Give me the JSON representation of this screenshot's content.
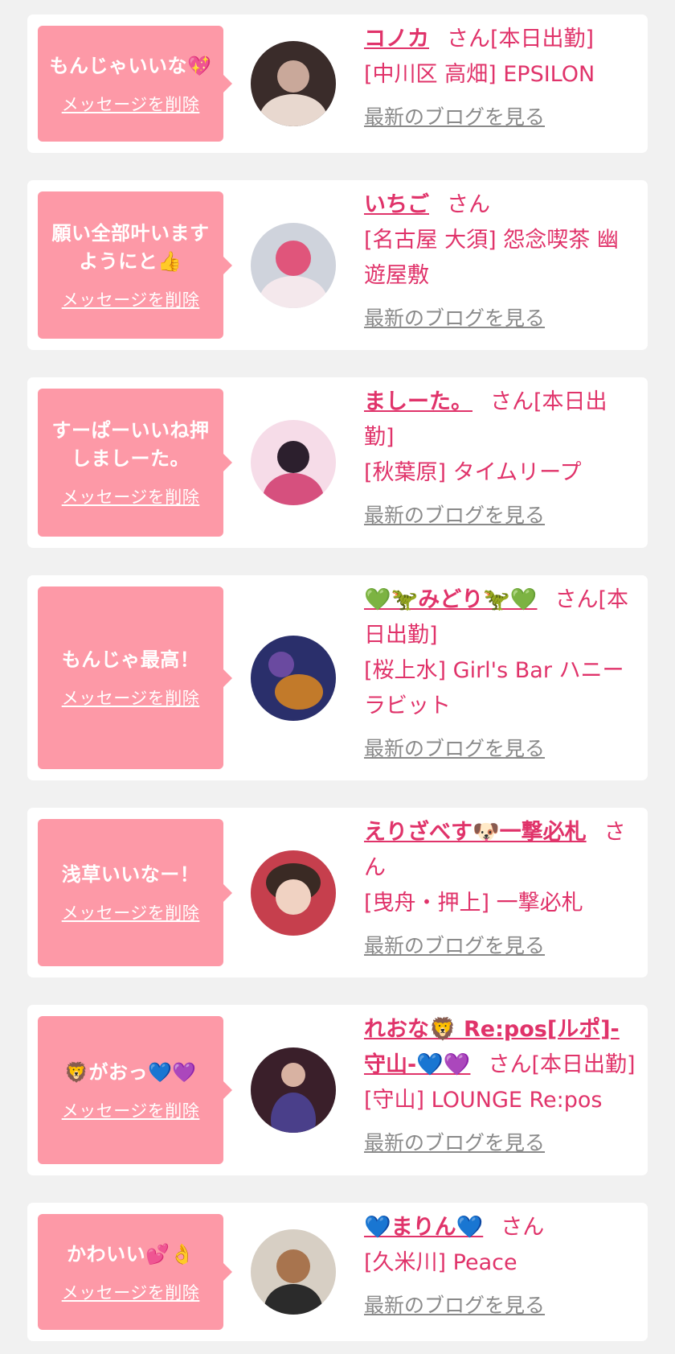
{
  "colors": {
    "page_bg": "#f1f1f1",
    "bubble_bg": "#fd99a7",
    "accent_text": "#e0336a",
    "blog_link": "#8a8a8a"
  },
  "delete_label": "メッセージを削除",
  "blog_label": "最新のブログを見る",
  "cards": [
    {
      "message": "もんじゃいいな💖",
      "name": "コノカ",
      "san": "さん[本日出勤]",
      "shop": "[中川区 高畑] EPSILON",
      "avatar_colors": [
        "#3a2c2a",
        "#e8d8cf",
        "#c9a89a"
      ]
    },
    {
      "message": "願い全部叶いますようにと👍",
      "name": "いちご",
      "san": "さん",
      "shop": "[名古屋 大須] 怨念喫茶 幽遊屋敷",
      "avatar_colors": [
        "#cfd3dc",
        "#e0557b",
        "#f4e8ec"
      ]
    },
    {
      "message": "すーぱーいいね押しましーた。",
      "name": "ましーた。",
      "san": "さん[本日出勤]",
      "shop": "[秋葉原] タイムリープ",
      "avatar_colors": [
        "#f6dce8",
        "#2c1f2d",
        "#d6507e"
      ]
    },
    {
      "message": "もんじゃ最高！",
      "name": "💚🦖みどり🦖💚",
      "san": "さん[本日出勤]",
      "shop": "[桜上水] Girl's Bar ハニーラビット",
      "avatar_colors": [
        "#2a2f6b",
        "#c27a2a",
        "#6a4aa0"
      ]
    },
    {
      "message": "浅草いいなー！",
      "name": "えりざべす🐶一撃必札",
      "san": "さん",
      "shop": "[曳舟・押上] 一撃必札",
      "avatar_colors": [
        "#c63f4d",
        "#f0d2c2",
        "#3a2a24"
      ]
    },
    {
      "message": "🦁がおっ💙💜",
      "name": "れおな🦁 Re:pos[ルポ]-守山-💙💜",
      "san": "さん[本日出勤]",
      "shop": "[守山] LOUNGE Re:pos",
      "avatar_colors": [
        "#3a1f2a",
        "#4a3f8a",
        "#d8b2a2"
      ]
    },
    {
      "message": "かわいい💕👌",
      "name": "💙まりん💙",
      "san": "さん",
      "shop": "[久米川] Peace",
      "avatar_colors": [
        "#d7cfc4",
        "#a8744e",
        "#2b2b2b"
      ]
    }
  ]
}
